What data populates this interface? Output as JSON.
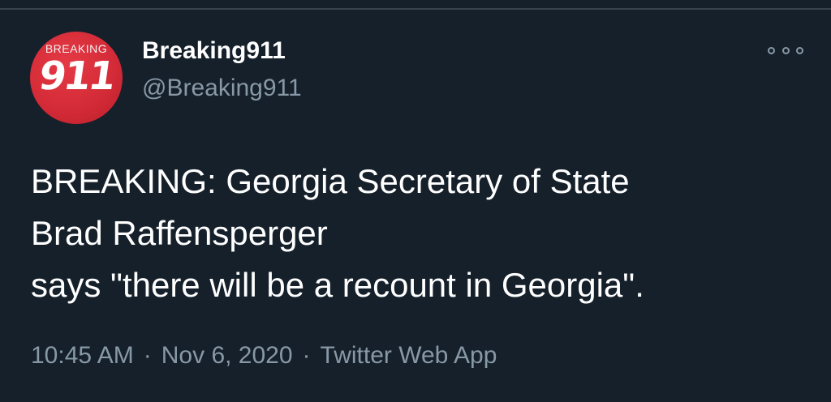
{
  "tweet": {
    "avatar": {
      "top_text": "BREAKING",
      "number_text": "911"
    },
    "display_name": "Breaking911",
    "handle": "@Breaking911",
    "more_icon": "more-options-icon",
    "text_lines": [
      "BREAKING: Georgia Secretary of State",
      "Brad Raffensperger",
      "says \"there will be a recount in Georgia\"."
    ],
    "time": "10:45 AM",
    "date": "Nov 6, 2020",
    "source": "Twitter Web App",
    "separator": "·"
  },
  "colors": {
    "background": "#15202b",
    "primary_text": "#ffffff",
    "secondary_text": "#8899a6",
    "avatar_red": "#d22a36"
  }
}
